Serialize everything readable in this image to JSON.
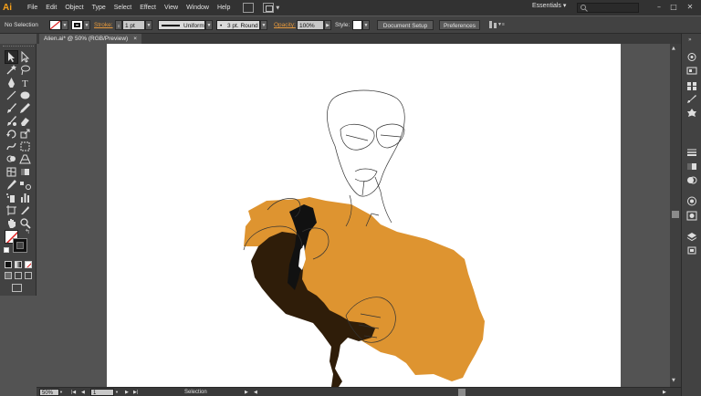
{
  "app": {
    "logo": "Ai",
    "workspace": "Essentials"
  },
  "menu": [
    "File",
    "Edit",
    "Object",
    "Type",
    "Select",
    "Effect",
    "View",
    "Window",
    "Help"
  ],
  "control": {
    "selection_label": "No Selection",
    "stroke_label": "Stroke:",
    "stroke_weight": "1 pt",
    "stroke_profile": "Uniform",
    "brush_def": "3 pt. Round",
    "opacity_label": "Opacity:",
    "opacity_value": "100%",
    "style_label": "Style:",
    "document_setup": "Document Setup",
    "preferences": "Preferences"
  },
  "document": {
    "tab_title": "Alien.ai* @ 50% (RGB/Preview)",
    "close_glyph": "×"
  },
  "status": {
    "zoom": "50%",
    "artboard": "1",
    "tool": "Selection"
  },
  "colors": {
    "accent": "#f7a11a",
    "artwork_orange": "#de9430",
    "artwork_brown": "#2f1d09"
  },
  "icons": {
    "tools": [
      "selection-tool",
      "direct-selection-tool",
      "magic-wand-tool",
      "lasso-tool",
      "pen-tool",
      "type-tool",
      "line-tool",
      "ellipse-tool",
      "paintbrush-tool",
      "pencil-tool",
      "blob-brush-tool",
      "eraser-tool",
      "rotate-tool",
      "scale-tool",
      "warp-tool",
      "free-transform-tool",
      "shape-builder-tool",
      "perspective-grid-tool",
      "mesh-tool",
      "gradient-tool",
      "eyedropper-tool",
      "blend-tool",
      "symbol-sprayer-tool",
      "column-graph-tool",
      "artboard-tool",
      "slice-tool",
      "hand-tool",
      "zoom-tool"
    ]
  }
}
